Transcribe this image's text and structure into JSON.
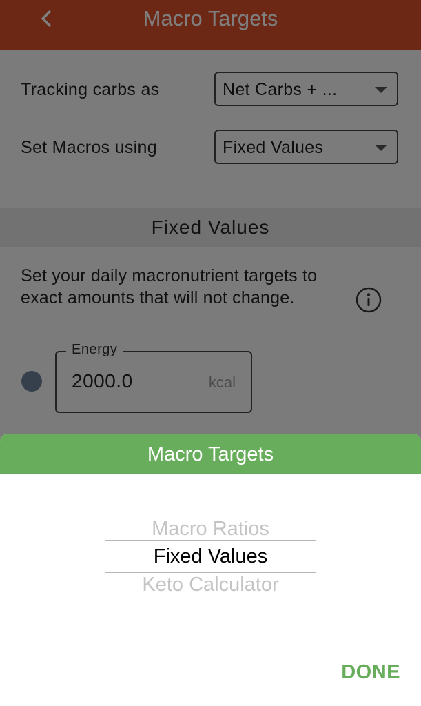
{
  "header": {
    "title": "Macro Targets",
    "color": "#d9502a"
  },
  "settings": {
    "tracking_label": "Tracking carbs as",
    "tracking_value": "Net Carbs + ...",
    "set_macros_label": "Set Macros using",
    "set_macros_value": "Fixed Values"
  },
  "section": {
    "title": "Fixed Values",
    "description": "Set your daily macronutrient targets to exact amounts that will not change."
  },
  "energy": {
    "label": "Energy",
    "value": "2000.0",
    "unit": "kcal"
  },
  "picker_sheet": {
    "title": "Macro Targets",
    "options": [
      "Macro Ratios",
      "Fixed Values",
      "Keto Calculator"
    ],
    "selected": "Fixed Values",
    "done_label": "DONE",
    "accent_color": "#67ad5b"
  }
}
